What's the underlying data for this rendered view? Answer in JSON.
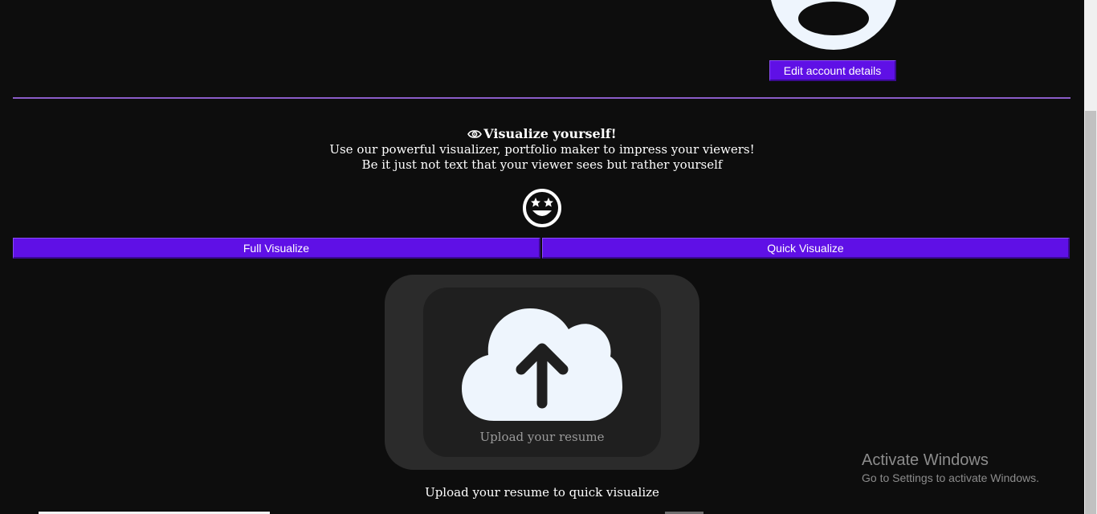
{
  "account": {
    "edit_label": "Edit account details"
  },
  "visualize": {
    "title": "Visualize yourself!",
    "line1": "Use our powerful visualizer, portfolio maker to impress your viewers!",
    "line2": "Be it just not text that your viewer sees but rather yourself"
  },
  "actions": {
    "full_label": "Full Visualize",
    "quick_label": "Quick Visualize"
  },
  "upload": {
    "label": "Upload your resume",
    "caption": "Upload your resume to quick visualize"
  },
  "windows_watermark": {
    "title": "Activate Windows",
    "subtitle": "Go to Settings to activate Windows."
  },
  "icons": {
    "visualize": "eye-icon",
    "emoji": "star-eyes-smile-icon",
    "upload": "cloud-upload-icon"
  },
  "colors": {
    "background": "#0d0d0d",
    "accent": "#5f10e6",
    "divider": "#8a5cc8",
    "upload_card": "#2b2b2b",
    "icon_fill": "#eef5fd"
  }
}
